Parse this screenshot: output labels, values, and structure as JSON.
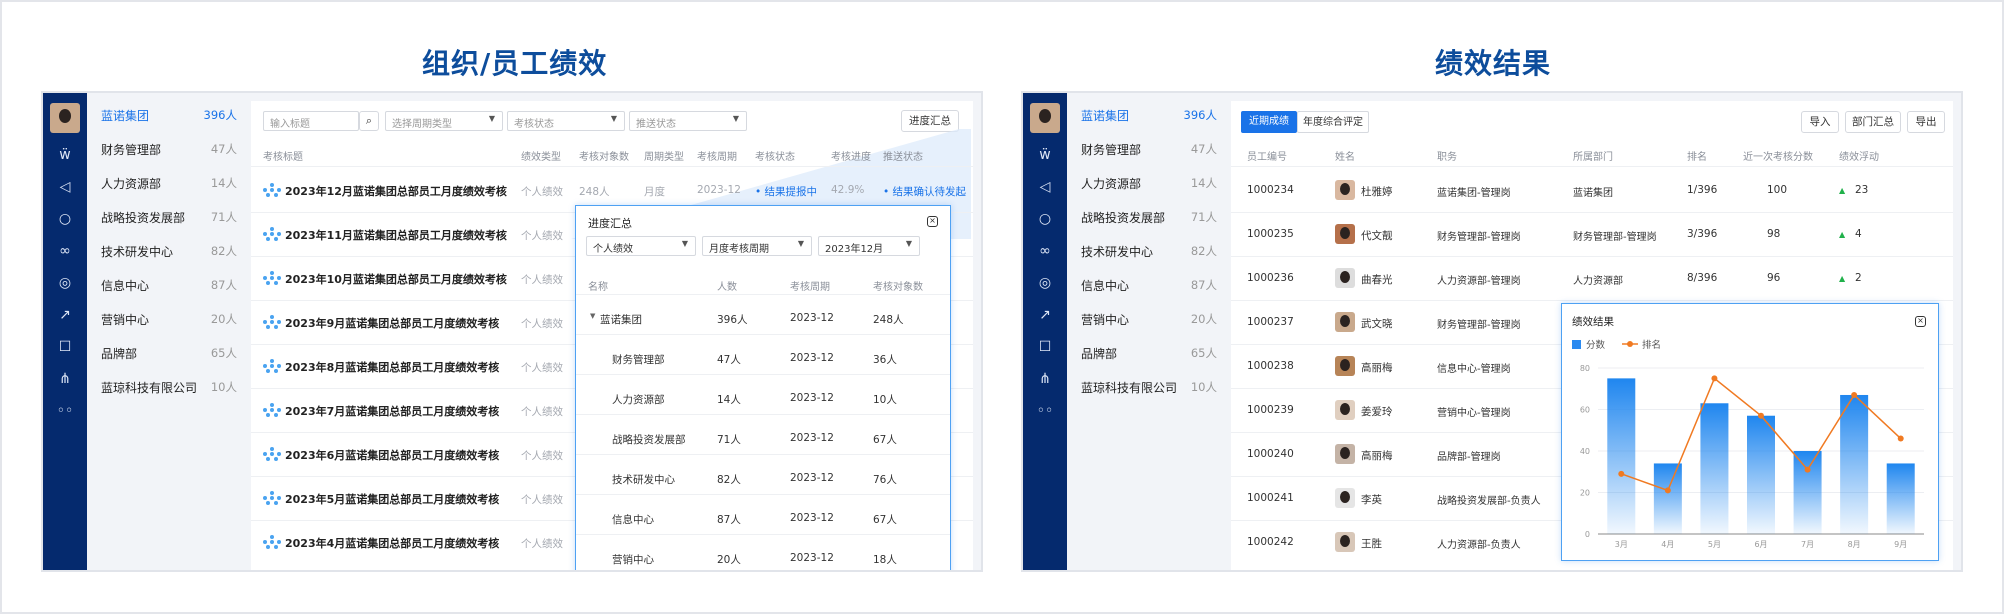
{
  "left_title": "组织/员工绩效",
  "right_title": "绩效结果",
  "departments": [
    {
      "name": "蓝诺集团",
      "count": "396人",
      "active": true
    },
    {
      "name": "财务管理部",
      "count": "47人"
    },
    {
      "name": "人力资源部",
      "count": "14人"
    },
    {
      "name": "战略投资发展部",
      "count": "71人"
    },
    {
      "name": "技术研发中心",
      "count": "82人"
    },
    {
      "name": "信息中心",
      "count": "87人"
    },
    {
      "name": "营销中心",
      "count": "20人"
    },
    {
      "name": "品牌部",
      "count": "65人"
    },
    {
      "name": "蓝琼科技有限公司",
      "count": "10人"
    }
  ],
  "left": {
    "filters": {
      "title_placeholder": "输入标题",
      "cycle_type": "选择周期类型",
      "review_status": "考核状态",
      "push_status": "推送状态",
      "summary_button": "进度汇总"
    },
    "headers": [
      "考核标题",
      "绩效类型",
      "考核对象数",
      "周期类型",
      "考核周期",
      "考核状态",
      "考核进度",
      "推送状态"
    ],
    "rows": [
      {
        "title": "2023年12月蓝诺集团总部员工月度绩效考核",
        "type": "个人绩效",
        "objects": "248人",
        "cycle": "月度",
        "period": "2023-12",
        "status": "结果提报中",
        "progress": "42.9%",
        "push": "结果确认待发起"
      },
      {
        "title": "2023年11月蓝诺集团总部员工月度绩效考核",
        "type": "个人绩效"
      },
      {
        "title": "2023年10月蓝诺集团总部员工月度绩效考核",
        "type": "个人绩效"
      },
      {
        "title": "2023年9月蓝诺集团总部员工月度绩效考核",
        "type": "个人绩效"
      },
      {
        "title": "2023年8月蓝诺集团总部员工月度绩效考核",
        "type": "个人绩效"
      },
      {
        "title": "2023年7月蓝诺集团总部员工月度绩效考核",
        "type": "个人绩效"
      },
      {
        "title": "2023年6月蓝诺集团总部员工月度绩效考核",
        "type": "个人绩效"
      },
      {
        "title": "2023年5月蓝诺集团总部员工月度绩效考核",
        "type": "个人绩效"
      },
      {
        "title": "2023年4月蓝诺集团总部员工月度绩效考核",
        "type": "个人绩效"
      }
    ],
    "popup": {
      "title": "进度汇总",
      "filter1": "个人绩效",
      "filter2": "月度考核周期",
      "filter3": "2023年12月",
      "headers": [
        "名称",
        "人数",
        "考核周期",
        "考核对象数"
      ],
      "rows": [
        {
          "name": "蓝诺集团",
          "people": "396人",
          "period": "2023-12",
          "objects": "248人",
          "root": true
        },
        {
          "name": "财务管理部",
          "people": "47人",
          "period": "2023-12",
          "objects": "36人"
        },
        {
          "name": "人力资源部",
          "people": "14人",
          "period": "2023-12",
          "objects": "10人"
        },
        {
          "name": "战略投资发展部",
          "people": "71人",
          "period": "2023-12",
          "objects": "67人"
        },
        {
          "name": "技术研发中心",
          "people": "82人",
          "period": "2023-12",
          "objects": "76人"
        },
        {
          "name": "信息中心",
          "people": "87人",
          "period": "2023-12",
          "objects": "67人"
        },
        {
          "name": "营销中心",
          "people": "20人",
          "period": "2023-12",
          "objects": "18人"
        }
      ]
    }
  },
  "right": {
    "tabs": [
      "近期成绩",
      "年度综合评定"
    ],
    "buttons": [
      "导入",
      "部门汇总",
      "导出"
    ],
    "headers": [
      "员工编号",
      "姓名",
      "职务",
      "所属部门",
      "排名",
      "近一次考核分数",
      "绩效浮动"
    ],
    "rows": [
      {
        "id": "1000234",
        "name": "杜雅婷",
        "job": "蓝诺集团-管理岗",
        "dept": "蓝诺集团",
        "rank": "1/396",
        "score": "100",
        "delta": "23",
        "avatar": "#d9b8a0"
      },
      {
        "id": "1000235",
        "name": "代文靓",
        "job": "财务管理部-管理岗",
        "dept": "财务管理部-管理岗",
        "rank": "3/396",
        "score": "98",
        "delta": "4",
        "avatar": "#b5704a"
      },
      {
        "id": "1000236",
        "name": "曲春光",
        "job": "人力资源部-管理岗",
        "dept": "人力资源部",
        "rank": "8/396",
        "score": "96",
        "delta": "2",
        "avatar": "#ddd"
      },
      {
        "id": "1000237",
        "name": "武文晓",
        "job": "财务管理部-管理岗",
        "avatar": "#c9a98c"
      },
      {
        "id": "1000238",
        "name": "高丽梅",
        "job": "信息中心-管理岗",
        "avatar": "#b78457"
      },
      {
        "id": "1000239",
        "name": "姜爱玲",
        "job": "营销中心-管理岗",
        "avatar": "#e0cfc0"
      },
      {
        "id": "1000240",
        "name": "高丽梅",
        "job": "品牌部-管理岗",
        "avatar": "#c4b3a6"
      },
      {
        "id": "1000241",
        "name": "李英",
        "job": "战略投资发展部-负责人",
        "avatar": "#e5e5e5"
      },
      {
        "id": "1000242",
        "name": "王胜",
        "job": "人力资源部-负责人",
        "avatar": "#d8c7b8"
      }
    ],
    "popup_title": "绩效结果"
  },
  "chart_data": {
    "type": "bar",
    "title": "绩效结果",
    "categories": [
      "3月",
      "4月",
      "5月",
      "6月",
      "7月",
      "8月",
      "9月"
    ],
    "series": [
      {
        "name": "分数",
        "type": "bar",
        "values": [
          75,
          34,
          63,
          57,
          40,
          67,
          34
        ],
        "color": "#2b8af0"
      },
      {
        "name": "排名",
        "type": "line",
        "values": [
          29,
          21,
          75,
          57,
          31,
          67,
          46
        ],
        "color": "#f07a22"
      }
    ],
    "ylim": [
      0,
      80
    ],
    "yticks": [
      "0",
      "20",
      "40",
      "60",
      "80"
    ],
    "legend": "top-left"
  }
}
